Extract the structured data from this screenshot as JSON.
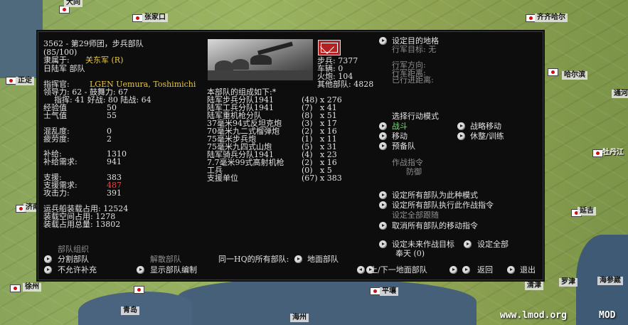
{
  "map": {
    "cities": [
      "大同",
      "张家口",
      "齐齐哈尔",
      "正定",
      "哈尔滨",
      "通河",
      "牡丹江",
      "济南",
      "延吉",
      "徐州",
      "平壤",
      "青岛",
      "海州",
      "清津",
      "罗津",
      "海参崴"
    ],
    "watermark_url": "www.lmod.org",
    "watermark_mod": "MOD"
  },
  "unit": {
    "name": "3562 - 第29师团，步兵部队",
    "strength": "(85/100)",
    "belongs_label": "隶属于:",
    "belongs_value": "关东军 (R)",
    "type_label": "日陆军 部队",
    "commander_label": "指挥官:",
    "commander_value": "LGEN Uemura, Toshimichi",
    "leadership": "领导力: 62 - 鼓舞力: 67",
    "command": "指挥: 41  好战: 80  陆战: 64",
    "exp_label": "经验值",
    "exp_value": "50",
    "morale_label": "士气值",
    "morale_value": "55",
    "disorg_label": "混乱度:",
    "disorg_value": "0",
    "fatigue_label": "疲劳度:",
    "fatigue_value": "2",
    "replace_label": "补给:",
    "replace_value": "1310",
    "replace_need_label": "补给需求:",
    "replace_need_value": "941",
    "support_label": "支援:",
    "support_value": "383",
    "support_need_label": "支援需求:",
    "support_need_value": "487",
    "attack_label": "攻击力:",
    "attack_value": "391",
    "transport_cap": "运兵船装载占用: 12524",
    "transport_used": "装载空间占用: 1278",
    "transport_total": "装载占用总量:  13802"
  },
  "stats": {
    "infantry": "步兵: 7377",
    "vehicles": "车辆: 0",
    "guns": "火炮: 104",
    "other": "其他部队: 4828"
  },
  "composition": {
    "heading": "本部队的组成如下:*",
    "rows": [
      {
        "name": "陆军步兵分队1941",
        "a": "(48)",
        "b": "x 276"
      },
      {
        "name": "陆军工兵分队1941",
        "a": "(7)",
        "b": "x 41"
      },
      {
        "name": "陆军重机枪分队",
        "a": "(8)",
        "b": "x 51"
      },
      {
        "name": "37毫米94式反坦克炮",
        "a": "(3)",
        "b": "x 17"
      },
      {
        "name": "70毫米九二式榴弹炮",
        "a": "(2)",
        "b": "x 16"
      },
      {
        "name": "75毫米步兵炮",
        "a": "(1)",
        "b": "x 11"
      },
      {
        "name": "75毫米九四式山炮",
        "a": "(5)",
        "b": "x 31"
      },
      {
        "name": "陆军骑兵分队1941",
        "a": "(4)",
        "b": "x 23"
      },
      {
        "name": "7.7毫米99式高射机枪",
        "a": "(2)",
        "b": "x 16"
      },
      {
        "name": "工兵",
        "a": "(0)",
        "b": "x 5"
      },
      {
        "name": "支援单位",
        "a": "(67)",
        "b": "x 383"
      }
    ]
  },
  "right": {
    "set_target": "设定目的地格",
    "march_target": "行军目标: 无",
    "march_dir": "行军方向:",
    "march_dist": "行军距离:",
    "march_done": "已行进距离:",
    "mode_heading": "选择行动模式",
    "mode_combat": "战斗",
    "mode_strategic": "战略移动",
    "mode_move": "移动",
    "mode_rest": "休整/训练",
    "mode_reserve": "预备队",
    "op_label": "作战指令",
    "op_value": "防御",
    "set_all_mode": "设定所有部队为此种模式",
    "set_all_op": "设定所有部队执行此作战指令",
    "set_all_follow": "设定全部跟随",
    "cancel_move": "取消所有部队的移动指令",
    "set_future_target": "设定未来作战目标",
    "set_all": "设定全部",
    "future_target_value": "奉天 (0)"
  },
  "bottom": {
    "org_label": "部队组织",
    "split": "分割部队",
    "disband": "解散部队",
    "no_replace": "不允许补充",
    "show_org": "显示部队编制",
    "same_hq": "同一HQ的所有部队:",
    "ground_units": "地面部队",
    "prev_next": "上/下一地面部队",
    "back": "返回",
    "exit": "退出"
  }
}
